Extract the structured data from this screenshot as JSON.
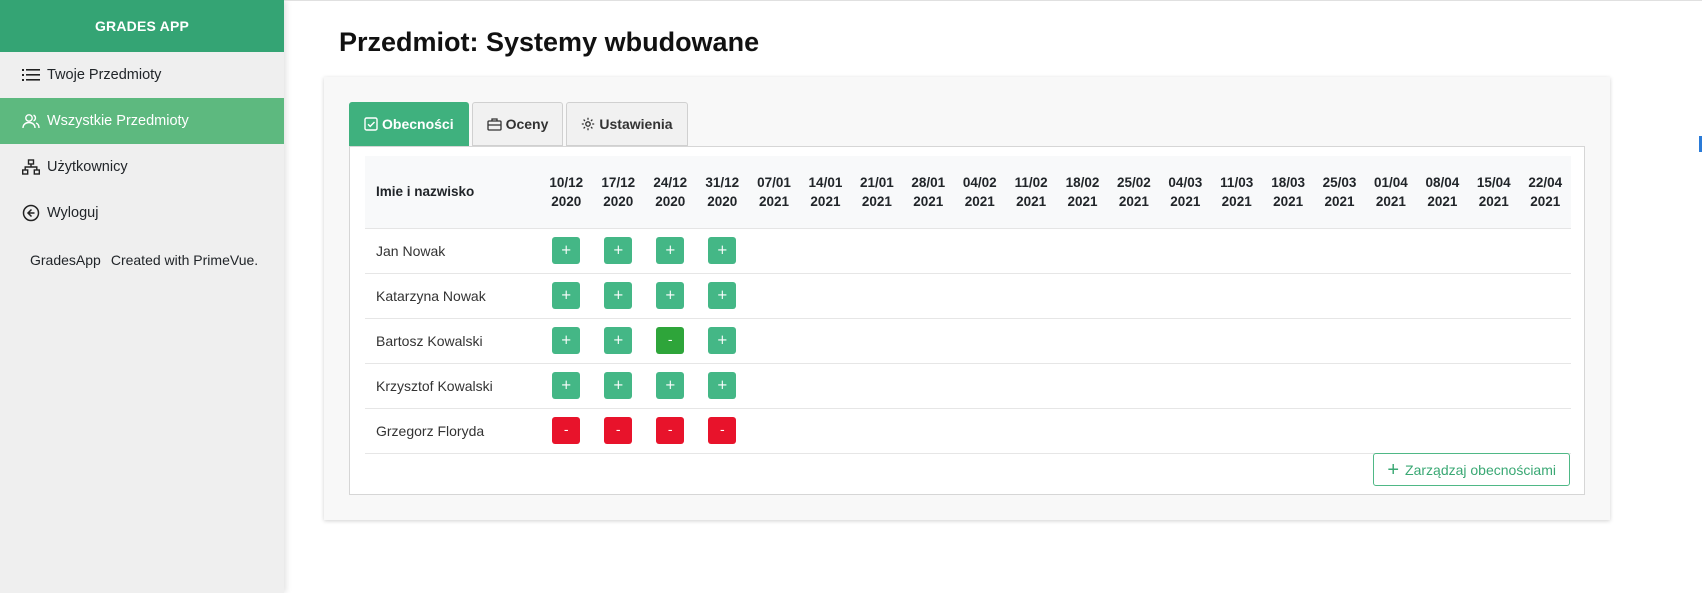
{
  "app": {
    "brand": "GRADES APP"
  },
  "sidebar": {
    "items": [
      {
        "label": "Twoje Przedmioty",
        "icon": "list-icon",
        "active": false
      },
      {
        "label": "Wszystkie Przedmioty",
        "icon": "users-icon",
        "active": true
      },
      {
        "label": "Użytkownicy",
        "icon": "sitemap-icon",
        "active": false
      },
      {
        "label": "Wyloguj",
        "icon": "arrow-circle-left-icon",
        "active": false
      }
    ],
    "credits": {
      "app": "GradesApp",
      "note": "Created with PrimeVue."
    }
  },
  "page": {
    "title": "Przedmiot: Systemy wbudowane"
  },
  "tabs": [
    {
      "label": "Obecności",
      "icon": "check-square-icon",
      "active": true
    },
    {
      "label": "Oceny",
      "icon": "briefcase-icon",
      "active": false
    },
    {
      "label": "Ustawienia",
      "icon": "cog-icon",
      "active": false
    }
  ],
  "attendance": {
    "name_header": "Imie i nazwisko",
    "dates": [
      [
        "10/12",
        "2020"
      ],
      [
        "17/12",
        "2020"
      ],
      [
        "24/12",
        "2020"
      ],
      [
        "31/12",
        "2020"
      ],
      [
        "07/01",
        "2021"
      ],
      [
        "14/01",
        "2021"
      ],
      [
        "21/01",
        "2021"
      ],
      [
        "28/01",
        "2021"
      ],
      [
        "04/02",
        "2021"
      ],
      [
        "11/02",
        "2021"
      ],
      [
        "18/02",
        "2021"
      ],
      [
        "25/02",
        "2021"
      ],
      [
        "04/03",
        "2021"
      ],
      [
        "11/03",
        "2021"
      ],
      [
        "18/03",
        "2021"
      ],
      [
        "25/03",
        "2021"
      ],
      [
        "01/04",
        "2021"
      ],
      [
        "08/04",
        "2021"
      ],
      [
        "15/04",
        "2021"
      ],
      [
        "22/04",
        "2021"
      ]
    ],
    "rows": [
      {
        "name": "Jan Nowak",
        "marks": [
          "+",
          "+",
          "+",
          "+"
        ],
        "status": [
          "present",
          "present",
          "present",
          "present"
        ]
      },
      {
        "name": "Katarzyna Nowak",
        "marks": [
          "+",
          "+",
          "+",
          "+"
        ],
        "status": [
          "present",
          "present",
          "present",
          "present"
        ]
      },
      {
        "name": "Bartosz Kowalski",
        "marks": [
          "+",
          "+",
          "-",
          "+"
        ],
        "status": [
          "present",
          "present",
          "excused",
          "present"
        ]
      },
      {
        "name": "Krzysztof Kowalski",
        "marks": [
          "+",
          "+",
          "+",
          "+"
        ],
        "status": [
          "present",
          "present",
          "present",
          "present"
        ]
      },
      {
        "name": "Grzegorz Floryda",
        "marks": [
          "-",
          "-",
          "-",
          "-"
        ],
        "status": [
          "absent",
          "absent",
          "absent",
          "absent"
        ]
      }
    ],
    "manage_button": "Zarządzaj obecnościami"
  },
  "colors": {
    "brand": "#34a474",
    "active_nav": "#5db97f",
    "present": "#44b786",
    "absent": "#e8132b",
    "excused": "#2ea53a"
  }
}
